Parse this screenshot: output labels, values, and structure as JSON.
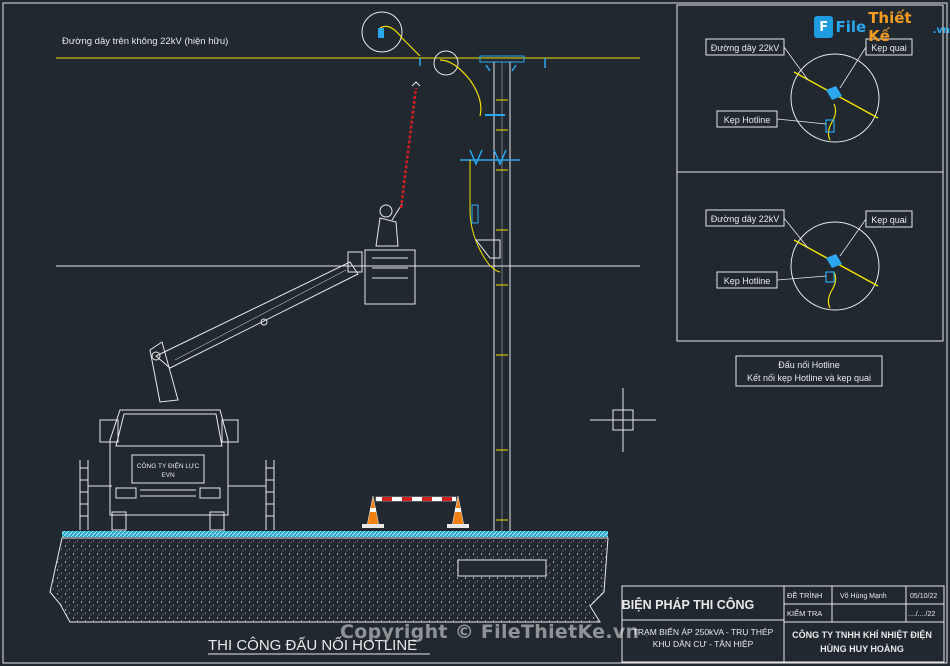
{
  "main": {
    "line_label": "Đường dây trên không 22kV (hiện hữu)",
    "truck_company": "CÔNG TY ĐIỆN LỰC",
    "truck_brand": "EVN",
    "drawing_title": "THI CÔNG ĐẤU NỐI HOTLINE"
  },
  "detail_top": {
    "line_label": "Đường dây 22kV",
    "clamp_label": "Kẹp quai",
    "hotline_label": "Kẹp Hotline"
  },
  "detail_bottom": {
    "line_label": "Đường dây 22kV",
    "clamp_label": "Kẹp quai",
    "hotline_label": "Kẹp Hotline"
  },
  "note": {
    "line1": "Đấu nối Hotline",
    "line2": "Kết nối kẹp Hotline và kẹp quai"
  },
  "title_block": {
    "method": "BIỆN PHÁP THI CÔNG",
    "project_line1": "TRẠM BIẾN ÁP 250kVA - TRỤ THÉP",
    "project_line2": "KHU DÂN CƯ - TÂN HIỆP",
    "row1_label": "ĐỀ TRÌNH",
    "row1_name": "Võ Hùng Mạnh",
    "row1_date": "05/10/22",
    "row2_label": "KIỂM TRA",
    "row2_date": "..../..../22",
    "company_line1": "CÔNG TY TNHH KHÍ NHIỆT ĐIỆN",
    "company_line2": "HÙNG HUY HOÀNG"
  },
  "branding": {
    "logo_mark": "F",
    "logo_text_1": "File",
    "logo_text_2": "Thiết Kế",
    "logo_tld": ".vn",
    "watermark": "Copyright © FileThietKe.vn"
  },
  "colors": {
    "background": "#212830",
    "line": "#e8e8e8",
    "conductor": "#f0e000",
    "accent": "#2aa7ee",
    "hot_stick": "#d02020"
  }
}
